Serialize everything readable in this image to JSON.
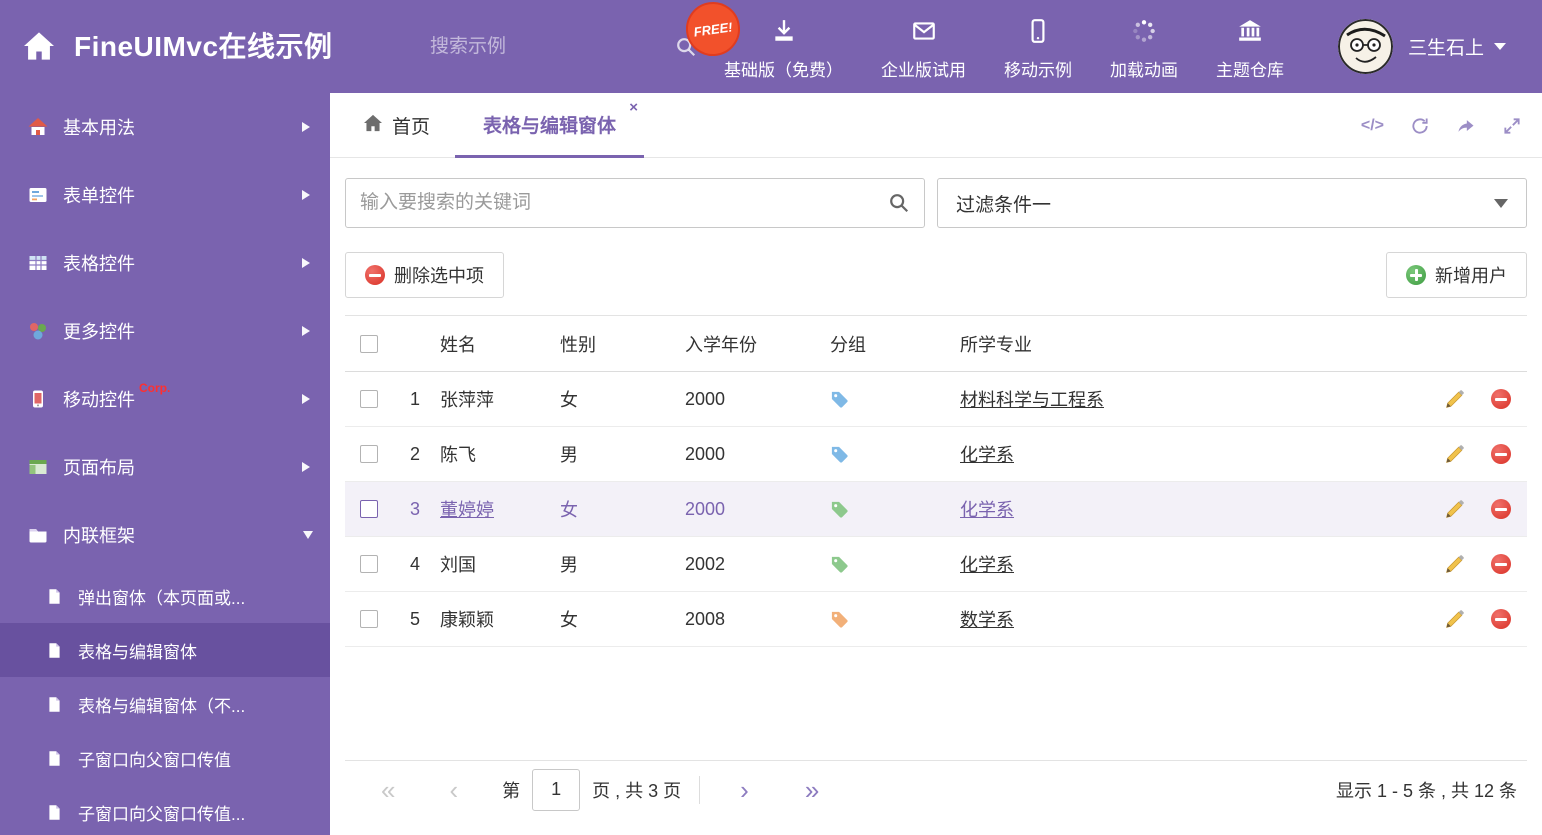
{
  "header": {
    "title": "FineUIMvc在线示例",
    "search_placeholder": "搜索示例",
    "free_badge": "FREE!",
    "nav": [
      {
        "label": "基础版（免费）"
      },
      {
        "label": "企业版试用"
      },
      {
        "label": "移动示例"
      },
      {
        "label": "加载动画"
      },
      {
        "label": "主题仓库"
      }
    ],
    "user_name": "三生石上"
  },
  "sidebar": {
    "items": [
      {
        "label": "基本用法"
      },
      {
        "label": "表单控件"
      },
      {
        "label": "表格控件"
      },
      {
        "label": "更多控件"
      },
      {
        "label": "移动控件",
        "badge": "Corp."
      },
      {
        "label": "页面布局"
      },
      {
        "label": "内联框架"
      }
    ],
    "subitems": [
      {
        "label": "弹出窗体（本页面或..."
      },
      {
        "label": "表格与编辑窗体"
      },
      {
        "label": "表格与编辑窗体（不..."
      },
      {
        "label": "子窗口向父窗口传值"
      },
      {
        "label": "子窗口向父窗口传值..."
      }
    ]
  },
  "tabbar": {
    "home_tab": "首页",
    "active_tab": "表格与编辑窗体",
    "close_glyph": "×",
    "code_icon_glyph": "</>"
  },
  "filters": {
    "search_placeholder": "输入要搜索的关键词",
    "filter_value": "过滤条件一"
  },
  "toolbar": {
    "delete_button": "删除选中项",
    "add_button": "新增用户"
  },
  "table": {
    "columns": {
      "name": "姓名",
      "gender": "性别",
      "year": "入学年份",
      "group": "分组",
      "major": "所学专业"
    },
    "rows": [
      {
        "num": "1",
        "name": "张萍萍",
        "gender": "女",
        "year": "2000",
        "tag_color": "#7fb9e6",
        "major": "材料科学与工程系",
        "selected": false
      },
      {
        "num": "2",
        "name": "陈飞",
        "gender": "男",
        "year": "2000",
        "tag_color": "#7fb9e6",
        "major": "化学系",
        "selected": false
      },
      {
        "num": "3",
        "name": "董婷婷",
        "gender": "女",
        "year": "2000",
        "tag_color": "#8dc98d",
        "major": "化学系",
        "selected": true
      },
      {
        "num": "4",
        "name": "刘国",
        "gender": "男",
        "year": "2002",
        "tag_color": "#8dc98d",
        "major": "化学系",
        "selected": false
      },
      {
        "num": "5",
        "name": "康颖颖",
        "gender": "女",
        "year": "2008",
        "tag_color": "#f2b079",
        "major": "数学系",
        "selected": false
      }
    ]
  },
  "pagination": {
    "first_icon": "«",
    "prev_icon": "‹",
    "next_icon": "›",
    "last_icon": "»",
    "page_prefix": "第",
    "current_page": "1",
    "page_suffix": "页 , 共 3 页",
    "summary": "显示 1 - 5 条 , 共 12 条"
  },
  "colors": {
    "theme_purple": "#7a63af",
    "sidebar_active": "#68519f",
    "danger_red": "#d93025",
    "success_green": "#4caf50"
  }
}
